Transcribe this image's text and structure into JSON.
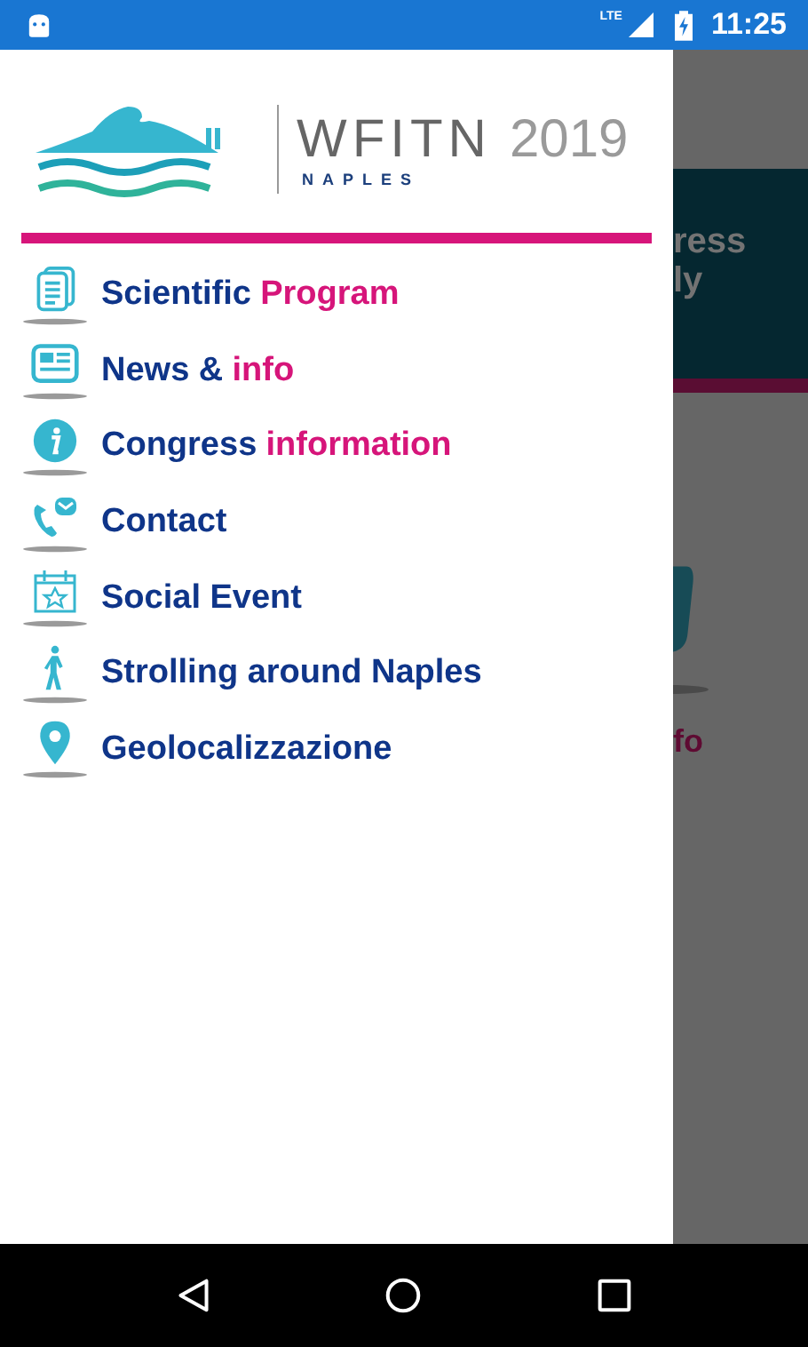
{
  "status_bar": {
    "network": "LTE",
    "time": "11:25"
  },
  "logo": {
    "name": "WFITN",
    "year": "2019",
    "city": "NAPLES"
  },
  "menu": [
    {
      "kind": "document",
      "label": "Scientific",
      "highlight": "Program"
    },
    {
      "kind": "news",
      "label": "News &",
      "highlight": "info"
    },
    {
      "kind": "info",
      "label": "Congress",
      "highlight": "information"
    },
    {
      "kind": "contact",
      "label": "Contact"
    },
    {
      "kind": "calendar",
      "label": "Social Event"
    },
    {
      "kind": "walk",
      "label": "Strolling around Naples"
    },
    {
      "kind": "pin",
      "label": "Geolocalizzazione"
    }
  ],
  "background_page": {
    "banner_lines": [
      "ress",
      "ly"
    ],
    "tile_label": "fo"
  }
}
